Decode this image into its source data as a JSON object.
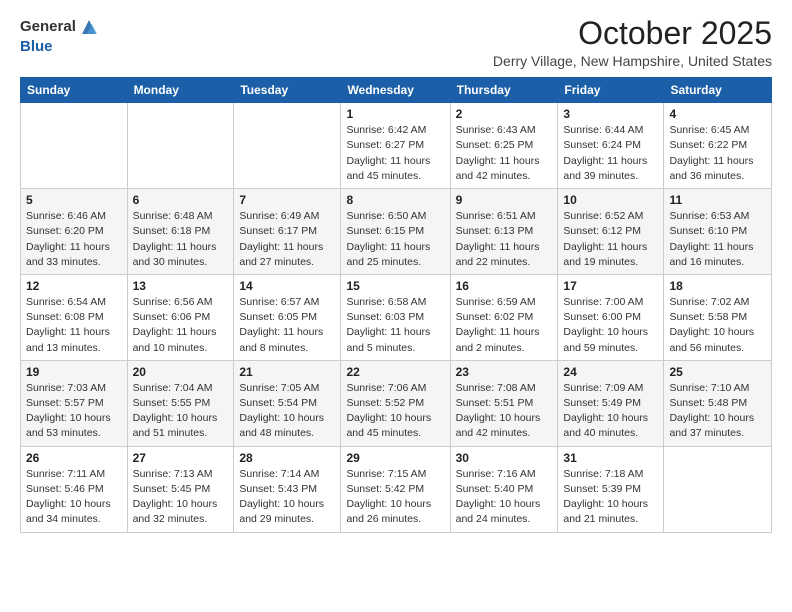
{
  "header": {
    "logo_general": "General",
    "logo_blue": "Blue",
    "month_year": "October 2025",
    "location": "Derry Village, New Hampshire, United States"
  },
  "calendar": {
    "headers": [
      "Sunday",
      "Monday",
      "Tuesday",
      "Wednesday",
      "Thursday",
      "Friday",
      "Saturday"
    ],
    "weeks": [
      [
        {
          "day": "",
          "info": ""
        },
        {
          "day": "",
          "info": ""
        },
        {
          "day": "",
          "info": ""
        },
        {
          "day": "1",
          "info": "Sunrise: 6:42 AM\nSunset: 6:27 PM\nDaylight: 11 hours\nand 45 minutes."
        },
        {
          "day": "2",
          "info": "Sunrise: 6:43 AM\nSunset: 6:25 PM\nDaylight: 11 hours\nand 42 minutes."
        },
        {
          "day": "3",
          "info": "Sunrise: 6:44 AM\nSunset: 6:24 PM\nDaylight: 11 hours\nand 39 minutes."
        },
        {
          "day": "4",
          "info": "Sunrise: 6:45 AM\nSunset: 6:22 PM\nDaylight: 11 hours\nand 36 minutes."
        }
      ],
      [
        {
          "day": "5",
          "info": "Sunrise: 6:46 AM\nSunset: 6:20 PM\nDaylight: 11 hours\nand 33 minutes."
        },
        {
          "day": "6",
          "info": "Sunrise: 6:48 AM\nSunset: 6:18 PM\nDaylight: 11 hours\nand 30 minutes."
        },
        {
          "day": "7",
          "info": "Sunrise: 6:49 AM\nSunset: 6:17 PM\nDaylight: 11 hours\nand 27 minutes."
        },
        {
          "day": "8",
          "info": "Sunrise: 6:50 AM\nSunset: 6:15 PM\nDaylight: 11 hours\nand 25 minutes."
        },
        {
          "day": "9",
          "info": "Sunrise: 6:51 AM\nSunset: 6:13 PM\nDaylight: 11 hours\nand 22 minutes."
        },
        {
          "day": "10",
          "info": "Sunrise: 6:52 AM\nSunset: 6:12 PM\nDaylight: 11 hours\nand 19 minutes."
        },
        {
          "day": "11",
          "info": "Sunrise: 6:53 AM\nSunset: 6:10 PM\nDaylight: 11 hours\nand 16 minutes."
        }
      ],
      [
        {
          "day": "12",
          "info": "Sunrise: 6:54 AM\nSunset: 6:08 PM\nDaylight: 11 hours\nand 13 minutes."
        },
        {
          "day": "13",
          "info": "Sunrise: 6:56 AM\nSunset: 6:06 PM\nDaylight: 11 hours\nand 10 minutes."
        },
        {
          "day": "14",
          "info": "Sunrise: 6:57 AM\nSunset: 6:05 PM\nDaylight: 11 hours\nand 8 minutes."
        },
        {
          "day": "15",
          "info": "Sunrise: 6:58 AM\nSunset: 6:03 PM\nDaylight: 11 hours\nand 5 minutes."
        },
        {
          "day": "16",
          "info": "Sunrise: 6:59 AM\nSunset: 6:02 PM\nDaylight: 11 hours\nand 2 minutes."
        },
        {
          "day": "17",
          "info": "Sunrise: 7:00 AM\nSunset: 6:00 PM\nDaylight: 10 hours\nand 59 minutes."
        },
        {
          "day": "18",
          "info": "Sunrise: 7:02 AM\nSunset: 5:58 PM\nDaylight: 10 hours\nand 56 minutes."
        }
      ],
      [
        {
          "day": "19",
          "info": "Sunrise: 7:03 AM\nSunset: 5:57 PM\nDaylight: 10 hours\nand 53 minutes."
        },
        {
          "day": "20",
          "info": "Sunrise: 7:04 AM\nSunset: 5:55 PM\nDaylight: 10 hours\nand 51 minutes."
        },
        {
          "day": "21",
          "info": "Sunrise: 7:05 AM\nSunset: 5:54 PM\nDaylight: 10 hours\nand 48 minutes."
        },
        {
          "day": "22",
          "info": "Sunrise: 7:06 AM\nSunset: 5:52 PM\nDaylight: 10 hours\nand 45 minutes."
        },
        {
          "day": "23",
          "info": "Sunrise: 7:08 AM\nSunset: 5:51 PM\nDaylight: 10 hours\nand 42 minutes."
        },
        {
          "day": "24",
          "info": "Sunrise: 7:09 AM\nSunset: 5:49 PM\nDaylight: 10 hours\nand 40 minutes."
        },
        {
          "day": "25",
          "info": "Sunrise: 7:10 AM\nSunset: 5:48 PM\nDaylight: 10 hours\nand 37 minutes."
        }
      ],
      [
        {
          "day": "26",
          "info": "Sunrise: 7:11 AM\nSunset: 5:46 PM\nDaylight: 10 hours\nand 34 minutes."
        },
        {
          "day": "27",
          "info": "Sunrise: 7:13 AM\nSunset: 5:45 PM\nDaylight: 10 hours\nand 32 minutes."
        },
        {
          "day": "28",
          "info": "Sunrise: 7:14 AM\nSunset: 5:43 PM\nDaylight: 10 hours\nand 29 minutes."
        },
        {
          "day": "29",
          "info": "Sunrise: 7:15 AM\nSunset: 5:42 PM\nDaylight: 10 hours\nand 26 minutes."
        },
        {
          "day": "30",
          "info": "Sunrise: 7:16 AM\nSunset: 5:40 PM\nDaylight: 10 hours\nand 24 minutes."
        },
        {
          "day": "31",
          "info": "Sunrise: 7:18 AM\nSunset: 5:39 PM\nDaylight: 10 hours\nand 21 minutes."
        },
        {
          "day": "",
          "info": ""
        }
      ]
    ]
  }
}
